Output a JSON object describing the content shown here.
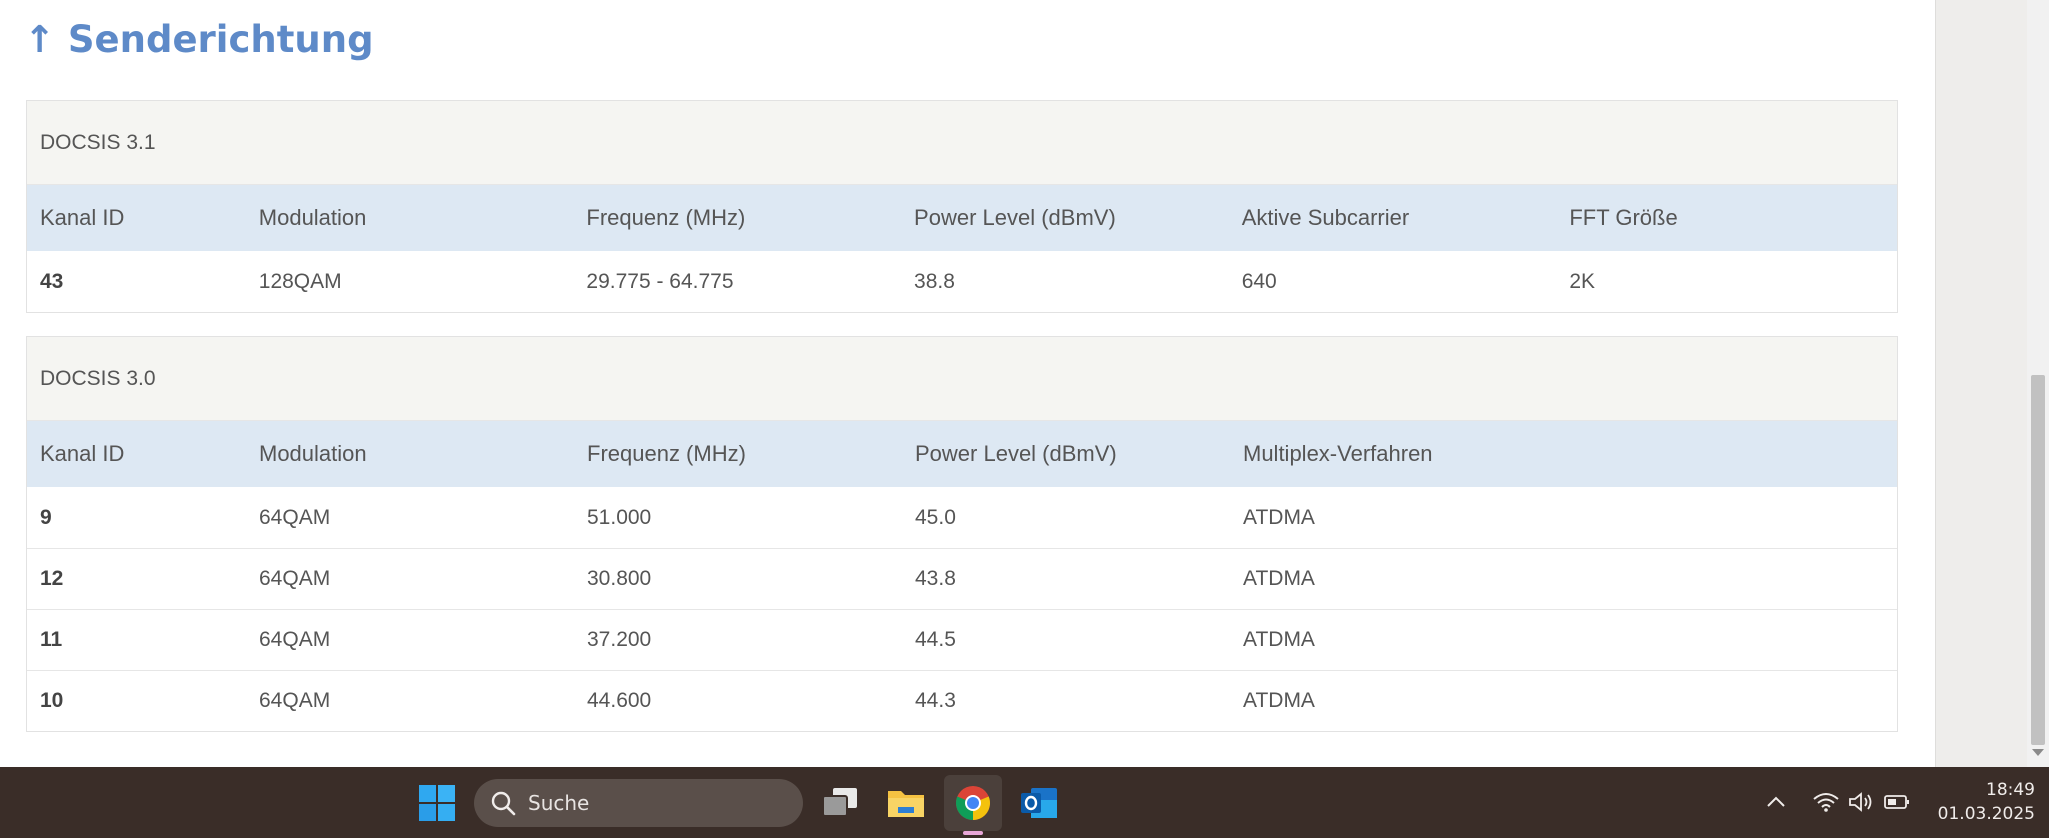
{
  "section": {
    "title": "↑ Senderichtung"
  },
  "docsis31": {
    "header": "DOCSIS 3.1",
    "columns": [
      "Kanal ID",
      "Modulation",
      "Frequenz (MHz)",
      "Power Level (dBmV)",
      "Aktive Subcarrier",
      "FFT Größe"
    ],
    "rows": [
      [
        "43",
        "128QAM",
        "29.775 - 64.775",
        "38.8",
        "640",
        "2K"
      ]
    ]
  },
  "docsis30": {
    "header": "DOCSIS 3.0",
    "columns": [
      "Kanal ID",
      "Modulation",
      "Frequenz (MHz)",
      "Power Level (dBmV)",
      "Multiplex-Verfahren"
    ],
    "rows": [
      [
        "9",
        "64QAM",
        "51.000",
        "45.0",
        "ATDMA"
      ],
      [
        "12",
        "64QAM",
        "30.800",
        "43.8",
        "ATDMA"
      ],
      [
        "11",
        "64QAM",
        "37.200",
        "44.5",
        "ATDMA"
      ],
      [
        "10",
        "64QAM",
        "44.600",
        "44.3",
        "ATDMA"
      ]
    ]
  },
  "taskbar": {
    "search_placeholder": "Suche",
    "apps": [
      "windows-start-icon",
      "task-view-icon",
      "file-explorer-icon",
      "chrome-icon",
      "outlook-icon"
    ],
    "tray_icons": [
      "chevron-up-icon",
      "wifi-icon",
      "speaker-icon",
      "battery-icon"
    ],
    "time": "18:49",
    "date": "01.03.2025"
  },
  "colors": {
    "title": "#5e8ac8",
    "table_header_bg": "#dde8f3",
    "card_header_bg": "#f5f5f2",
    "taskbar_bg": "#3a2d28"
  }
}
